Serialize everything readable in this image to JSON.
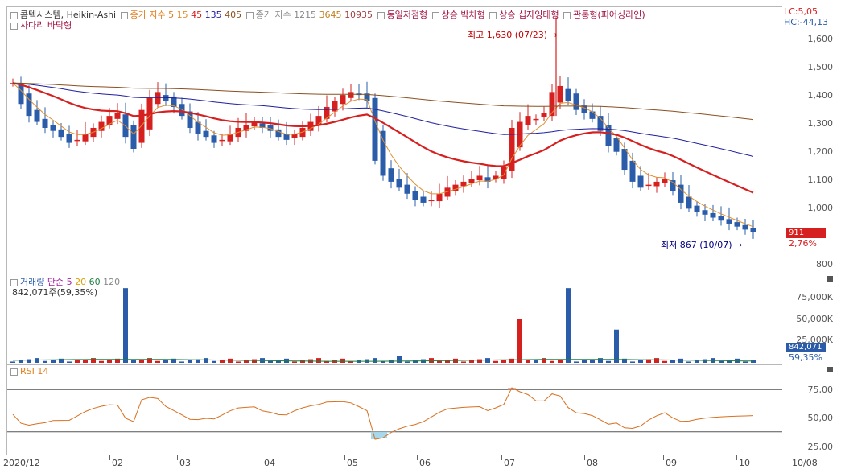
{
  "legend": {
    "name": "콤텍시스템, Heikin-Ashi",
    "ma_label": "종가 지수 5",
    "ma_periods": [
      "15",
      "45",
      "135",
      "405"
    ],
    "ma2_label": "종가 지수 1215",
    "ma2_periods": [
      "3645",
      "10935"
    ],
    "patterns": [
      "동일저점형",
      "상승 박차형",
      "상승 십자잉태형",
      "관통형(피어싱라인)"
    ],
    "pattern2": "사다리 바닥형"
  },
  "price_info": {
    "lc": "LC:5,05",
    "hc": "HC:-44,13",
    "current": "911",
    "change": "2,76%"
  },
  "annotations": {
    "high": "최고 1,630 (07/23)",
    "low": "최저 867 (10/07)"
  },
  "volume_legend": {
    "title": "거래량",
    "ma_type": "단순",
    "periods": [
      "5",
      "20",
      "60",
      "120"
    ],
    "value": "842,071주(59,35%)",
    "current": "842,071",
    "pct": "59,35%"
  },
  "rsi_legend": {
    "title": "RSI 14"
  },
  "x_labels": [
    "2020/12",
    "02",
    "03",
    "04",
    "05",
    "06",
    "07",
    "08",
    "09",
    "10",
    "10/08"
  ],
  "colors": {
    "up": "#d62020",
    "down": "#2a5caa",
    "ma5": "#e09030",
    "ma20": "#d62020",
    "ma60": "#2020a0",
    "ma120": "#8a5020"
  },
  "chart_data": [
    {
      "type": "candlestick",
      "title": "콤텍시스템, Heikin-Ashi",
      "y_ticks": [
        "1,600",
        "1,500",
        "1,400",
        "1,300",
        "1,200",
        "1,100",
        "1,000",
        "800"
      ],
      "ylim": [
        800,
        1650
      ],
      "x_ticks": [
        "2020/12",
        "02",
        "03",
        "04",
        "05",
        "06",
        "07",
        "08",
        "09",
        "10",
        "10/08"
      ],
      "series": [
        {
          "name": "종가",
          "values": [
            1410,
            1340,
            1300,
            1280,
            1260,
            1250,
            1230,
            1210,
            1220,
            1240,
            1260,
            1280,
            1300,
            1310,
            1230,
            1190,
            1320,
            1360,
            1380,
            1350,
            1330,
            1300,
            1260,
            1240,
            1230,
            1210,
            1220,
            1240,
            1260,
            1270,
            1280,
            1260,
            1250,
            1230,
            1220,
            1240,
            1260,
            1280,
            1300,
            1330,
            1350,
            1370,
            1380,
            1370,
            1350,
            1150,
            1100,
            1080,
            1060,
            1040,
            1020,
            1010,
            1020,
            1040,
            1060,
            1070,
            1080,
            1090,
            1100,
            1080,
            1100,
            1130,
            1260,
            1280,
            1300,
            1290,
            1310,
            1380,
            1400,
            1350,
            1320,
            1310,
            1290,
            1250,
            1200,
            1180,
            1120,
            1080,
            1060,
            1070,
            1080,
            1090,
            1050,
            1010,
            990,
            980,
            970,
            960,
            950,
            940,
            930,
            920,
            911
          ]
        }
      ]
    },
    {
      "type": "bar",
      "title": "거래량",
      "y_ticks": [
        "75,000K",
        "50,000K",
        "25,000K"
      ],
      "ylim": [
        0,
        95000
      ],
      "annotated_values": [
        {
          "label": "842,071",
          "value": 842
        }
      ]
    },
    {
      "type": "line",
      "title": "RSI 14",
      "y_ticks": [
        "75,00",
        "50,00",
        "25,00"
      ],
      "ylim": [
        10,
        90
      ]
    }
  ]
}
